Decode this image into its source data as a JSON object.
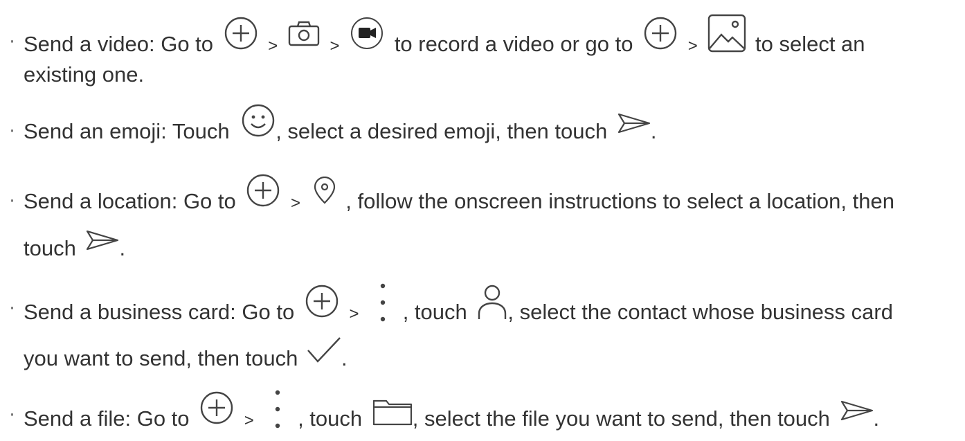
{
  "items": [
    {
      "lead": "Send a video: Go to",
      "gt": ">",
      "mid1": "to record a video or go to",
      "tail": "to select an",
      "cont": "existing one."
    },
    {
      "lead": "Send an emoji: Touch",
      "mid": ", select a desired emoji, then touch",
      "end": "."
    },
    {
      "lead": "Send a location: Go to",
      "gt": ">",
      "mid": ", follow the onscreen instructions to select a location, then",
      "cont": "touch",
      "end": "."
    },
    {
      "lead": "Send a business card: Go to",
      "gt": ">",
      "mid1": ", touch",
      "mid2": ", select the contact whose business card",
      "cont": "you want to send, then touch",
      "end": "."
    },
    {
      "lead": "Send a file: Go to",
      "gt": ">",
      "mid1": ", touch",
      "mid2": ", select the file you want to send, then touch",
      "end": "."
    }
  ],
  "bullet": "·",
  "icons": [
    "add-circle-icon",
    "camera-icon",
    "video-record-icon",
    "gallery-icon",
    "emoji-icon",
    "send-icon",
    "location-icon",
    "more-vertical-icon",
    "contact-icon",
    "checkmark-icon",
    "folder-icon"
  ],
  "colors": {
    "text": "#333333",
    "icon_stroke": "#444444",
    "bullet": "#777777"
  }
}
